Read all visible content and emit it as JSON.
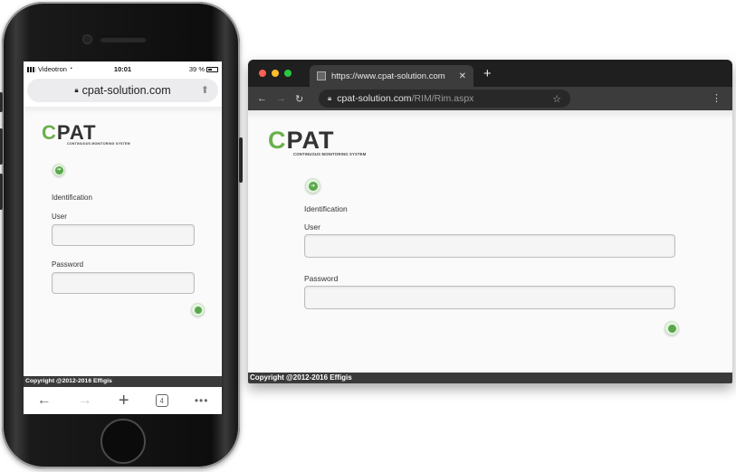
{
  "mobile": {
    "status": {
      "carrier": "Videotron",
      "time": "10:01",
      "battery": "39 %"
    },
    "url": "cpat-solution.com",
    "toolbar": {
      "tab_count": "4"
    }
  },
  "desktop": {
    "tab_title": "https://www.cpat-solution.com",
    "url_host": "cpat-solution.com",
    "url_path": "/RIM/Rim.aspx"
  },
  "page": {
    "logo": {
      "c": "C",
      "rest": "PAT",
      "tagline": "CONTINUOUS MONITORING SYSTEM"
    },
    "section_label": "Identification",
    "user_label": "User",
    "password_label": "Password",
    "user_value": "",
    "password_value": "",
    "footer": "Copyright @2012-2016 Effigis"
  },
  "colors": {
    "brand_green": "#6ab04c",
    "footer_bg": "#3a3a3a",
    "chrome_dark": "#1f1f1f"
  },
  "icons": [
    "lock-icon",
    "share-icon",
    "back-arrow-icon",
    "forward-arrow-icon",
    "plus-icon",
    "tabs-icon",
    "more-icon",
    "reload-icon",
    "star-icon",
    "menu-icon",
    "go-button-icon"
  ]
}
